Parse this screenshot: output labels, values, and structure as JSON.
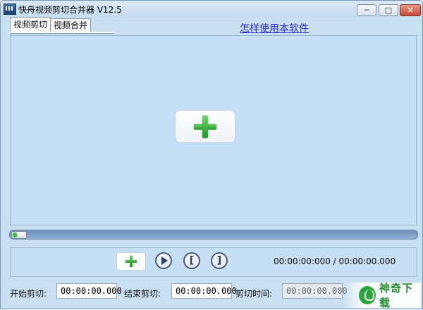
{
  "window": {
    "title": "快舟视频剪切合并器 V12.5",
    "min_icon": "minimize-icon",
    "max_icon": "maximize-icon",
    "close_icon": "close-icon"
  },
  "tabs": [
    {
      "label": "视频剪切",
      "active": true
    },
    {
      "label": "视频合并",
      "active": false
    }
  ],
  "help_link": "怎样使用本软件",
  "preview": {
    "add_button_icon": "plus-icon"
  },
  "progress": {
    "position": 0.0
  },
  "controls": {
    "add_icon": "plus-icon",
    "play_icon": "play-icon",
    "mark_in_label": "[",
    "mark_out_label": "]",
    "time_display": "00:00:00:000 / 00:00:00.000"
  },
  "cut": {
    "start_label": "开始剪切:",
    "start_value": "00:00:00.000",
    "end_label": "结束剪切:",
    "end_value": "00:00:00.000",
    "duration_label": "剪切时间:",
    "duration_value": "00:00:00.000"
  },
  "watermark": {
    "text": "神奇下载"
  },
  "colors": {
    "window_bg": "#c9e0f3",
    "preview_bg": "#c4dff7",
    "progress_track": "#7f9fc8",
    "accent_green": "#1e9a28",
    "link": "#2b2bc8"
  }
}
